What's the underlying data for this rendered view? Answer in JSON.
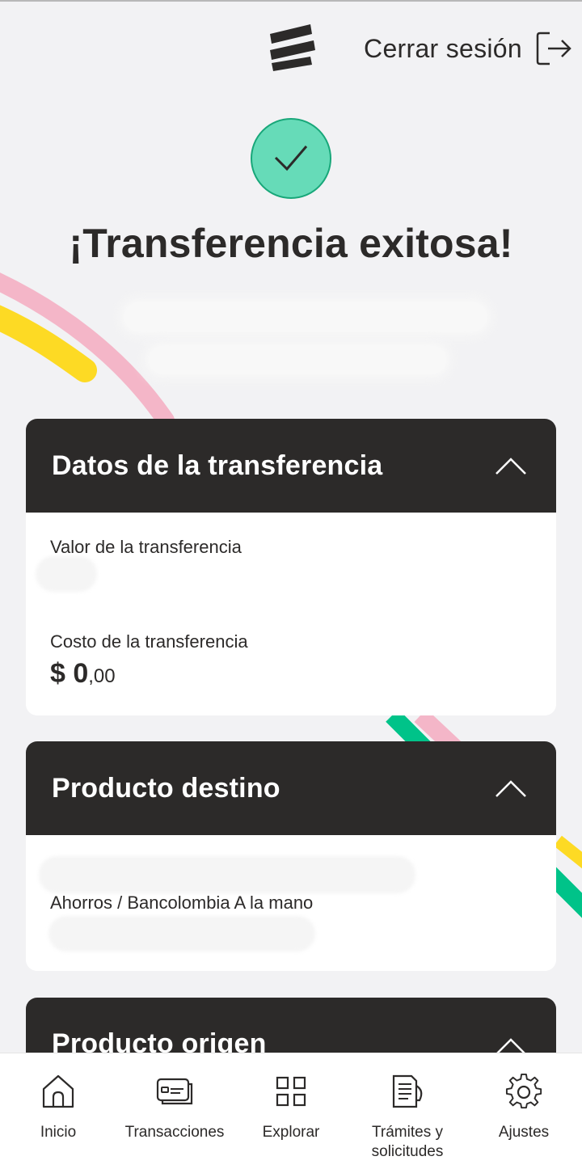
{
  "header": {
    "logout_label": "Cerrar sesión",
    "logo_icon": "bancolombia-logo-icon",
    "logout_icon": "logout-icon"
  },
  "status": {
    "icon": "check-icon",
    "title": "¡Transferencia exitosa!"
  },
  "cards": {
    "details": {
      "title": "Datos de la transferencia",
      "value_label": "Valor de la transferencia",
      "cost_label": "Costo de la transferencia",
      "cost_main": "$ 0",
      "cost_cents": ",00"
    },
    "destination": {
      "title": "Producto destino",
      "account_type": "Ahorros / Bancolombia A la mano"
    },
    "origin": {
      "title": "Producto origen"
    }
  },
  "nav": {
    "items": [
      {
        "label": "Inicio",
        "icon": "home-icon"
      },
      {
        "label": "Transacciones",
        "icon": "transactions-icon"
      },
      {
        "label": "Explorar",
        "icon": "grid-icon"
      },
      {
        "label": "Trámites y\nsolicitudes",
        "icon": "document-icon"
      },
      {
        "label": "Ajustes",
        "icon": "gear-icon"
      }
    ]
  },
  "colors": {
    "dark": "#2c2a29",
    "success_fill": "#66dbb8",
    "success_border": "#18a779",
    "ribbon_pink": "#f4b6c8",
    "ribbon_yellow": "#fdda24",
    "ribbon_green": "#00c389"
  }
}
